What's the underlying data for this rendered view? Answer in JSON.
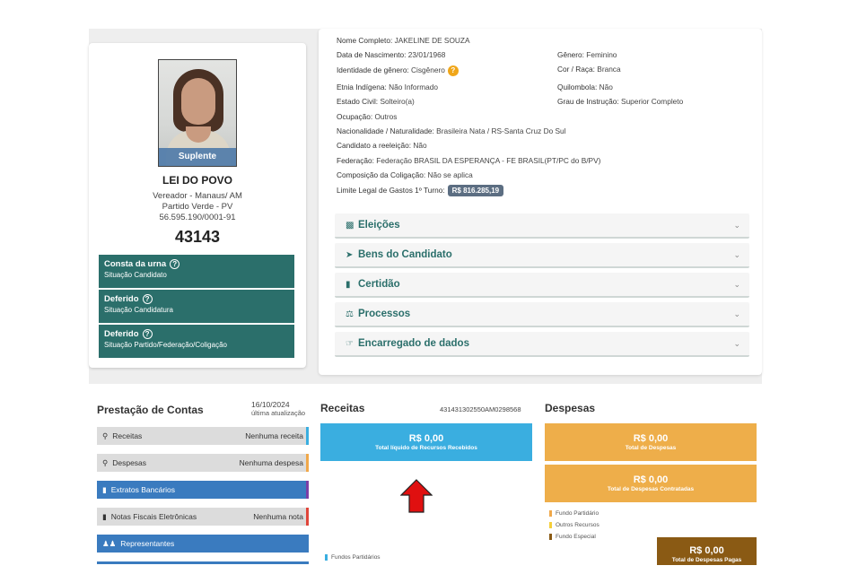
{
  "candidate": {
    "photo_badge": "Suplente",
    "name": "LEI DO POVO",
    "role": "Vereador - Manaus/ AM",
    "party": "Partido Verde - PV",
    "cnpj": "56.595.190/0001-91",
    "number": "43143",
    "statuses": [
      {
        "title": "Consta da urna",
        "subtitle": "Situação Candidato"
      },
      {
        "title": "Deferido",
        "subtitle": "Situação Candidatura"
      },
      {
        "title": "Deferido",
        "subtitle": "Situação Partido/Federação/Coligação"
      }
    ]
  },
  "details": {
    "full_name_label": "Nome Completo:",
    "full_name": "JAKELINE DE SOUZA",
    "birth_label": "Data de Nascimento:",
    "birth": "23/01/1968",
    "gender_label": "Gênero:",
    "gender": "Feminino",
    "gender_identity_label": "Identidade de gênero:",
    "gender_identity": "Cisgênero",
    "race_label": "Cor / Raça:",
    "race": "Branca",
    "ethnicity_label": "Etnia Indígena:",
    "ethnicity": "Não Informado",
    "quilombola_label": "Quilombola:",
    "quilombola": "Não",
    "civil_label": "Estado Civil:",
    "civil": "Solteiro(a)",
    "education_label": "Grau de Instrução:",
    "education": "Superior Completo",
    "occupation_label": "Ocupação:",
    "occupation": "Outros",
    "nationality_label": "Nacionalidade / Naturalidade:",
    "nationality": "Brasileira Nata / RS-Santa Cruz Do Sul",
    "reelection_label": "Candidato a reeleição:",
    "reelection": "Não",
    "federation_label": "Federação:",
    "federation": "Federação BRASIL DA ESPERANÇA - FE BRASIL(PT/PC do B/PV)",
    "coalition_label": "Composição da Coligação:",
    "coalition": "Não se aplica",
    "limit_label": "Limite Legal de Gastos 1º Turno:",
    "limit": "R$ 816.285,19"
  },
  "accordion": [
    {
      "label": "Eleições",
      "icon": "chart-icon"
    },
    {
      "label": "Bens do Candidato",
      "icon": "tag-icon"
    },
    {
      "label": "Certidão",
      "icon": "file-icon"
    },
    {
      "label": "Processos",
      "icon": "scale-icon"
    },
    {
      "label": "Encarregado de dados",
      "icon": "data-officer-icon"
    }
  ],
  "accounts": {
    "title": "Prestação de Contas",
    "date": "16/10/2024",
    "date_caption": "última atualização",
    "rows": [
      {
        "label": "Receitas",
        "value": "Nenhuma receita",
        "icon": "search-icon",
        "edge": "#3aaee0"
      },
      {
        "label": "Despesas",
        "value": "Nenhuma despesa",
        "icon": "search-icon",
        "edge": "#f0a84a"
      },
      {
        "label": "Extratos Bancários",
        "value": "",
        "icon": "file-icon",
        "edge": "#7d3fa6"
      },
      {
        "label": "Notas Fiscais Eletrônicas",
        "value": "Nenhuma nota",
        "icon": "file-icon",
        "edge": "#e0453a"
      },
      {
        "label": "Representantes",
        "value": "",
        "icon": "people-icon",
        "edge": ""
      }
    ]
  },
  "receitas": {
    "title": "Receitas",
    "receipt_number": "431431302550AM0298568",
    "total_amount": "R$ 0,00",
    "total_label": "Total líquido de Recursos Recebidos",
    "legend": "Fundos Partidários"
  },
  "despesas": {
    "title": "Despesas",
    "boxes": [
      {
        "amount": "R$ 0,00",
        "label": "Total de Despesas"
      },
      {
        "amount": "R$ 0,00",
        "label": "Total de Despesas Contratadas"
      },
      {
        "amount": "R$ 0,00",
        "label": "Total de Despesas Pagas"
      }
    ],
    "legend": [
      "Fundo Partidário",
      "Outros Recursos",
      "Fundo Especial"
    ]
  },
  "colors": {
    "teal": "#2b6f6b",
    "receitas_blue": "#3aaee0",
    "despesas_orange": "#eeae4a",
    "despesas_brown": "#8a5a14",
    "arrow_red": "#e01010"
  }
}
